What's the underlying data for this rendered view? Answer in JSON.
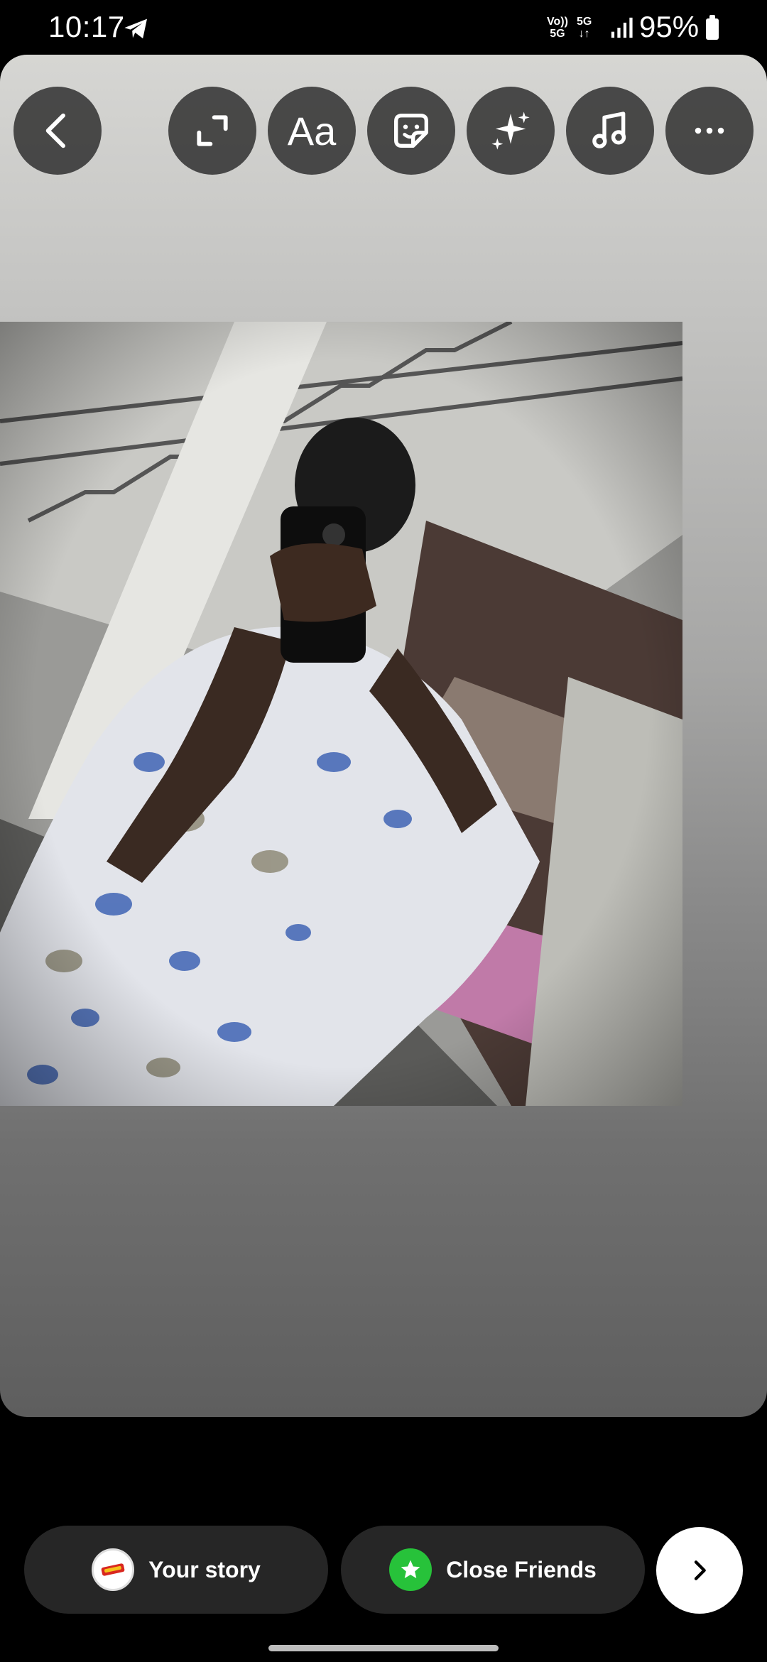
{
  "status_bar": {
    "time": "10:17",
    "network_volte_top": "Vo))",
    "network_volte_bottom": "5G",
    "network_type": "5G",
    "battery_percent": "95%"
  },
  "toolbar": {
    "text_tool_label": "Aa",
    "icons": [
      "back-icon",
      "resize-icon",
      "text-icon",
      "sticker-icon",
      "effects-icon",
      "music-icon",
      "more-icon"
    ]
  },
  "share": {
    "your_story_label": "Your story",
    "close_friends_label": "Close Friends",
    "close_friends_color": "#27c23a"
  }
}
